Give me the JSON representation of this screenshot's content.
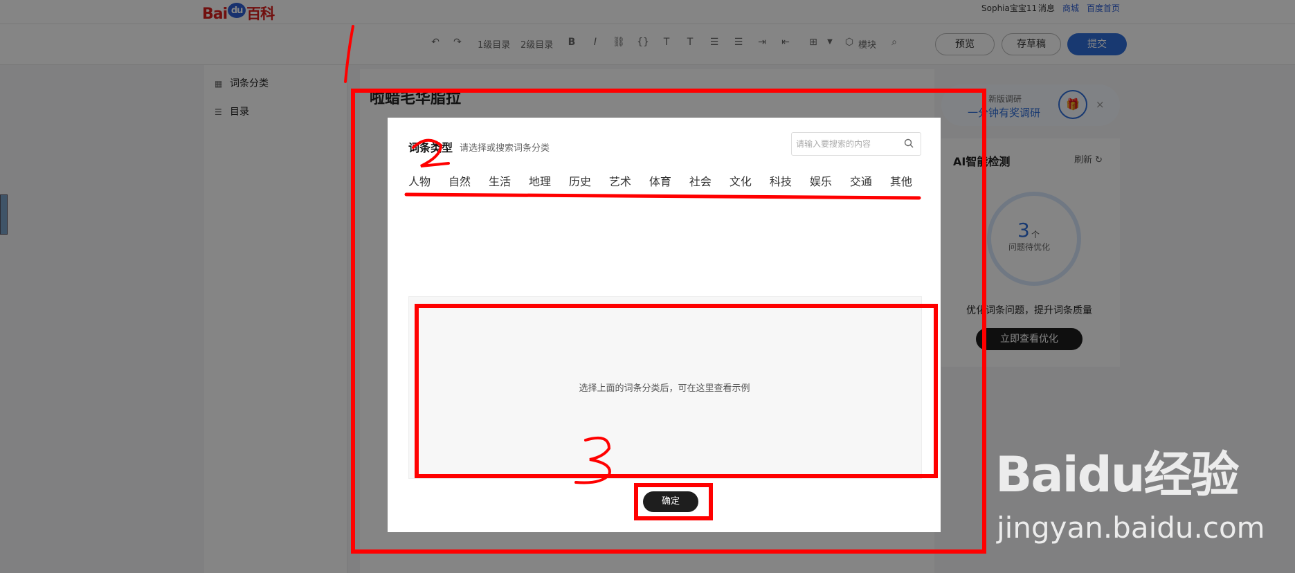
{
  "header": {
    "logo_text": "Baidu百科",
    "logo_parts": [
      "Bai",
      "du",
      "百科"
    ],
    "username": "Sophia宝宝11",
    "links": [
      "消息",
      "商城",
      "百度首页"
    ]
  },
  "toolbar": {
    "items": [
      "1级目录",
      "2级目录",
      "模块"
    ],
    "buttons": {
      "preview": "预览",
      "draft": "存草稿",
      "submit": "提交"
    }
  },
  "sidebar": {
    "items": [
      {
        "label": "词条分类",
        "icon": "grid-icon"
      },
      {
        "label": "目录",
        "icon": "list-icon"
      }
    ]
  },
  "entry": {
    "title": "啦蜡毛华脂拉"
  },
  "survey": {
    "line1": "新版调研",
    "line2": "一分钟有奖调研",
    "close": "×"
  },
  "ai_check": {
    "title": "AI智能检测",
    "refresh": "刷新",
    "count": "3",
    "count_unit": "个",
    "count_label": "问题待优化",
    "tip": "优化词条问题，提升词条质量",
    "button": "立即查看优化"
  },
  "modal": {
    "title": "词条类型",
    "hint": "请选择或搜索词条分类",
    "search_placeholder": "请输入要搜索的内容",
    "categories": [
      "人物",
      "自然",
      "生活",
      "地理",
      "历史",
      "艺术",
      "体育",
      "社会",
      "文化",
      "科技",
      "娱乐",
      "交通",
      "其他"
    ],
    "example_text": "选择上面的词条分类后，可在这里查看示例",
    "confirm": "确定"
  },
  "annotations": {
    "step1": "1",
    "step2": "2",
    "step3": "3",
    "color": "#ff0000"
  },
  "watermark": {
    "logo": "Baidu经验",
    "url": "jingyan.baidu.com"
  },
  "colors": {
    "accent": "#2f6dd8",
    "dark_button": "#1e1e1e",
    "annotation": "#ff0000"
  }
}
